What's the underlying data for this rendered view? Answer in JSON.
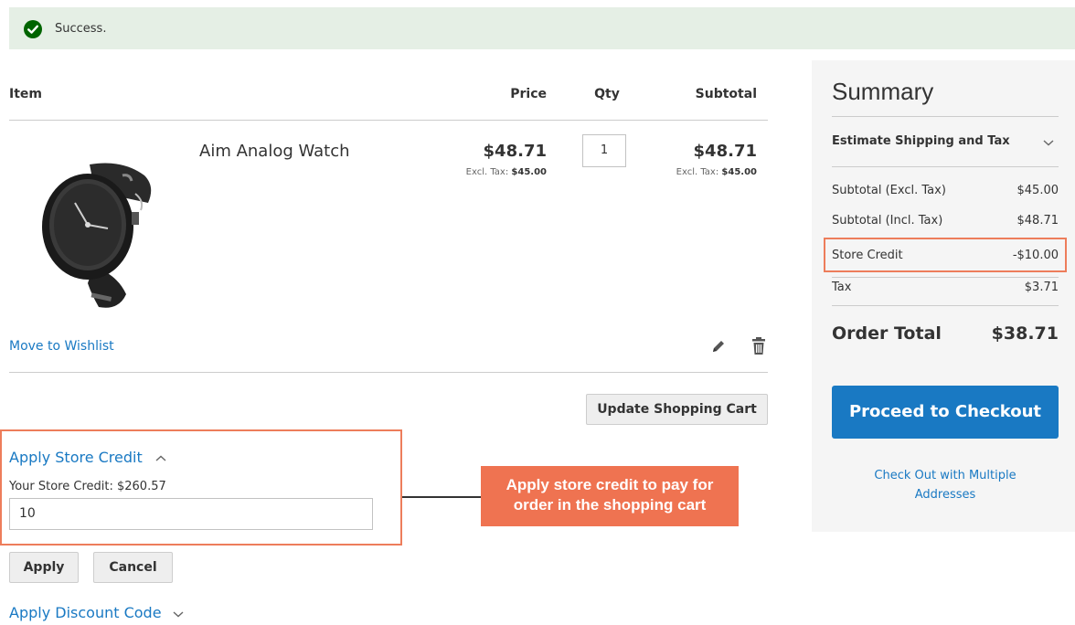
{
  "message": {
    "text": "Success.",
    "color": "#006400"
  },
  "cart": {
    "headers": {
      "item": "Item",
      "price": "Price",
      "qty": "Qty",
      "subtotal": "Subtotal"
    },
    "item": {
      "name": "Aim Analog Watch",
      "price": "$48.71",
      "price_excl_label": "Excl. Tax:",
      "price_excl_value": "$45.00",
      "qty": "1",
      "subtotal": "$48.71",
      "subtotal_excl_label": "Excl. Tax:",
      "subtotal_excl_value": "$45.00",
      "move_to_wishlist": "Move to Wishlist",
      "image_icon": "wristwatch-image"
    },
    "update_button": "Update Shopping Cart"
  },
  "store_credit": {
    "toggle_label": "Apply Store Credit",
    "balance_label": "Your Store Credit: $260.57",
    "input_value": "10",
    "apply_button": "Apply",
    "cancel_button": "Cancel"
  },
  "discount": {
    "toggle_label": "Apply Discount Code"
  },
  "annotation": {
    "line1": "Apply store credit to pay for",
    "line2": "order in the shopping cart",
    "color": "#ef7351"
  },
  "summary": {
    "title": "Summary",
    "estimate_label": "Estimate Shipping and Tax",
    "rows": [
      {
        "label": "Subtotal (Excl. Tax)",
        "value": "$45.00"
      },
      {
        "label": "Subtotal (Incl. Tax)",
        "value": "$48.71"
      },
      {
        "label": "Store Credit",
        "value": "-$10.00"
      },
      {
        "label": "Tax",
        "value": "$3.71"
      }
    ],
    "order_total_label": "Order Total",
    "order_total_value": "$38.71",
    "checkout_button": "Proceed to Checkout",
    "multi_address_line1": "Check Out with Multiple",
    "multi_address_line2": "Addresses"
  },
  "colors": {
    "accent": "#1979c3",
    "highlight": "#ed7d5b",
    "success_bg": "#e5efe5"
  }
}
